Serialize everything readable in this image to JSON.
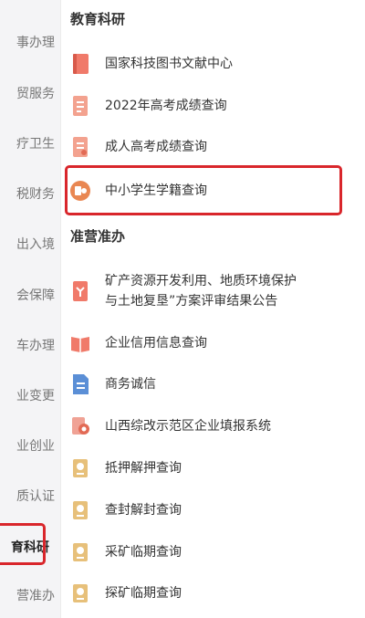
{
  "sidebar": {
    "items": [
      {
        "label": "事办理"
      },
      {
        "label": "贸服务"
      },
      {
        "label": "疗卫生"
      },
      {
        "label": "税财务"
      },
      {
        "label": "出入境"
      },
      {
        "label": "会保障"
      },
      {
        "label": "车办理"
      },
      {
        "label": "业变更"
      },
      {
        "label": "业创业"
      },
      {
        "label": "质认证"
      },
      {
        "label": "育科研"
      },
      {
        "label": "营准办"
      }
    ],
    "active_label": "育科研"
  },
  "sections": [
    {
      "title": "教育科研",
      "items": [
        {
          "label": "国家科技图书文献中心",
          "icon": "book-icon"
        },
        {
          "label": "2022年高考成绩查询",
          "icon": "exam-document-icon"
        },
        {
          "label": "成人高考成绩查询",
          "icon": "exam-document-icon"
        },
        {
          "label": "中小学生学籍查询",
          "icon": "student-record-icon"
        }
      ]
    },
    {
      "title": "准营准办",
      "items": [
        {
          "label_line1": "矿产资源开发利用、地质环境保护",
          "label_line2": "与土地复垦”方案评审结果公告",
          "icon": "document-icon"
        },
        {
          "label": "企业信用信息查询",
          "icon": "open-book-icon"
        },
        {
          "label": "商务诚信",
          "icon": "blue-document-icon"
        },
        {
          "label": "山西综改示范区企业填报系统",
          "icon": "badge-document-icon"
        },
        {
          "label": "抵押解押查询",
          "icon": "certificate-icon"
        },
        {
          "label": "查封解封查询",
          "icon": "certificate-icon"
        },
        {
          "label": "采矿临期查询",
          "icon": "certificate-icon"
        },
        {
          "label": "探矿临期查询",
          "icon": "certificate-icon"
        }
      ]
    }
  ],
  "colors": {
    "highlight": "#d9262b",
    "icon_red": "#f07a6a",
    "icon_orange": "#e98752",
    "icon_blue": "#5b8fd6",
    "icon_gold": "#e7c07a"
  }
}
